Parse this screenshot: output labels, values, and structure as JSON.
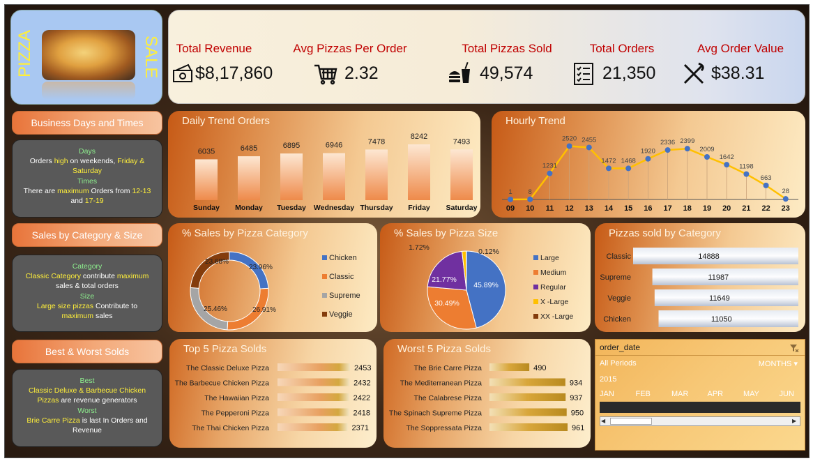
{
  "logo": {
    "left_text": "PIZZA",
    "right_text": "SALE"
  },
  "kpis": [
    {
      "label": "Total Revenue",
      "value": "$8,17,860",
      "icon": "money-icon"
    },
    {
      "label": "Avg Pizzas Per Order",
      "value": "2.32",
      "icon": "cart-icon"
    },
    {
      "label": "Total Pizzas Sold",
      "value": "49,574",
      "icon": "fast-food-icon"
    },
    {
      "label": "Total Orders",
      "value": "21,350",
      "icon": "checklist-icon"
    },
    {
      "label": "Avg Order Value",
      "value": "$38.31",
      "icon": "fork-knife-icon"
    }
  ],
  "side": {
    "s1": {
      "title": "Business Days and Times",
      "lines": [
        [
          {
            "t": "Days",
            "c": "g"
          }
        ],
        [
          {
            "t": "Orders "
          },
          {
            "t": "high",
            "c": "y"
          },
          {
            "t": " on weekends, "
          },
          {
            "t": "Friday &",
            "c": "y"
          }
        ],
        [
          {
            "t": "Saturday",
            "c": "y"
          }
        ],
        [
          {
            "t": "Times",
            "c": "g"
          }
        ],
        [
          {
            "t": "There are "
          },
          {
            "t": "maximum",
            "c": "y"
          },
          {
            "t": " Orders from "
          },
          {
            "t": "12-13",
            "c": "y"
          }
        ],
        [
          {
            "t": "and  "
          },
          {
            "t": "17-19",
            "c": "y"
          }
        ]
      ]
    },
    "s2": {
      "title": "Sales by Category & Size",
      "lines": [
        [
          {
            "t": "Category",
            "c": "g"
          }
        ],
        [
          {
            "t": "Classic Category",
            "c": "y"
          },
          {
            "t": " contribute "
          },
          {
            "t": "maximum",
            "c": "y"
          }
        ],
        [
          {
            "t": "sales & total orders"
          }
        ],
        [
          {
            "t": "Size",
            "c": "g"
          }
        ],
        [
          {
            "t": "Large size pizzas",
            "c": "y"
          },
          {
            "t": " Contribute to"
          }
        ],
        [
          {
            "t": "maximum",
            "c": "y"
          },
          {
            "t": " sales"
          }
        ]
      ]
    },
    "s3": {
      "title": "Best & Worst Solds",
      "lines": [
        [
          {
            "t": "Best",
            "c": "g"
          }
        ],
        [
          {
            "t": "Classic Deluxe & Barbecue Chicken",
            "c": "y"
          }
        ],
        [
          {
            "t": "Pizzas",
            "c": "y"
          },
          {
            "t": " are revenue generators"
          }
        ],
        [
          {
            "t": "Worst",
            "c": "g"
          }
        ],
        [
          {
            "t": "Brie Carre Pizza",
            "c": "y"
          },
          {
            "t": " is last In Orders and"
          }
        ],
        [
          {
            "t": "Revenue"
          }
        ]
      ]
    }
  },
  "slicer": {
    "field": "order_date",
    "periods": "All Periods",
    "unit": "MONTHS",
    "year": "2015",
    "months": [
      "JAN",
      "FEB",
      "MAR",
      "APR",
      "MAY",
      "JUN"
    ]
  },
  "chart_data": [
    {
      "id": "daily",
      "type": "bar",
      "title": "Daily Trend Orders",
      "categories": [
        "Sunday",
        "Monday",
        "Tuesday",
        "Wednesday",
        "Thursday",
        "Friday",
        "Saturday"
      ],
      "values": [
        6035,
        6485,
        6895,
        6946,
        7478,
        8242,
        7493
      ]
    },
    {
      "id": "hourly",
      "type": "line",
      "title": "Hourly Trend",
      "categories": [
        "09",
        "10",
        "11",
        "12",
        "13",
        "14",
        "15",
        "16",
        "17",
        "18",
        "19",
        "20",
        "21",
        "22",
        "23"
      ],
      "values": [
        1,
        8,
        1231,
        2520,
        2455,
        1472,
        1468,
        1920,
        2336,
        2399,
        2009,
        1642,
        1198,
        663,
        28
      ]
    },
    {
      "id": "category",
      "type": "pie",
      "title": "% Sales by Pizza Category",
      "labels": [
        "Chicken",
        "Classic",
        "Supreme",
        "Veggie"
      ],
      "values": [
        23.96,
        26.91,
        25.46,
        23.68
      ],
      "value_labels": [
        "23.96%",
        "26.91%",
        "25.46%",
        "23.68%"
      ],
      "colors": [
        "#4472c4",
        "#ed7d31",
        "#a5a5a5",
        "#843c0c"
      ]
    },
    {
      "id": "size",
      "type": "pie",
      "title": "% Sales by Pizza Size",
      "labels": [
        "Large",
        "Medium",
        "Regular",
        "X -Large",
        "XX -Large"
      ],
      "values": [
        45.89,
        30.49,
        21.77,
        1.72,
        0.12
      ],
      "value_labels": [
        "45.89%",
        "30.49%",
        "21.77%",
        "1.72%",
        "0.12%"
      ],
      "colors": [
        "#4472c4",
        "#ed7d31",
        "#7030a0",
        "#ffc000",
        "#843c0c"
      ]
    },
    {
      "id": "catsold",
      "type": "bar",
      "title": "Pizzas sold by Category",
      "categories": [
        "Classic",
        "Supreme",
        "Veggie",
        "Chicken"
      ],
      "values": [
        14888,
        11987,
        11649,
        11050
      ]
    },
    {
      "id": "top5",
      "type": "bar",
      "title": "Top 5 Pizza Solds",
      "categories": [
        "The Classic Deluxe Pizza",
        "The Barbecue Chicken Pizza",
        "The Hawaiian Pizza",
        "The Pepperoni Pizza",
        "The Thai Chicken Pizza"
      ],
      "values": [
        2453,
        2432,
        2422,
        2418,
        2371
      ]
    },
    {
      "id": "worst5",
      "type": "bar",
      "title": "Worst 5 Pizza Solds",
      "categories": [
        "The Brie Carre Pizza",
        "The Mediterranean Pizza",
        "The Calabrese Pizza",
        "The Spinach Supreme Pizza",
        "The Soppressata Pizza"
      ],
      "values": [
        490,
        934,
        937,
        950,
        961
      ]
    }
  ]
}
